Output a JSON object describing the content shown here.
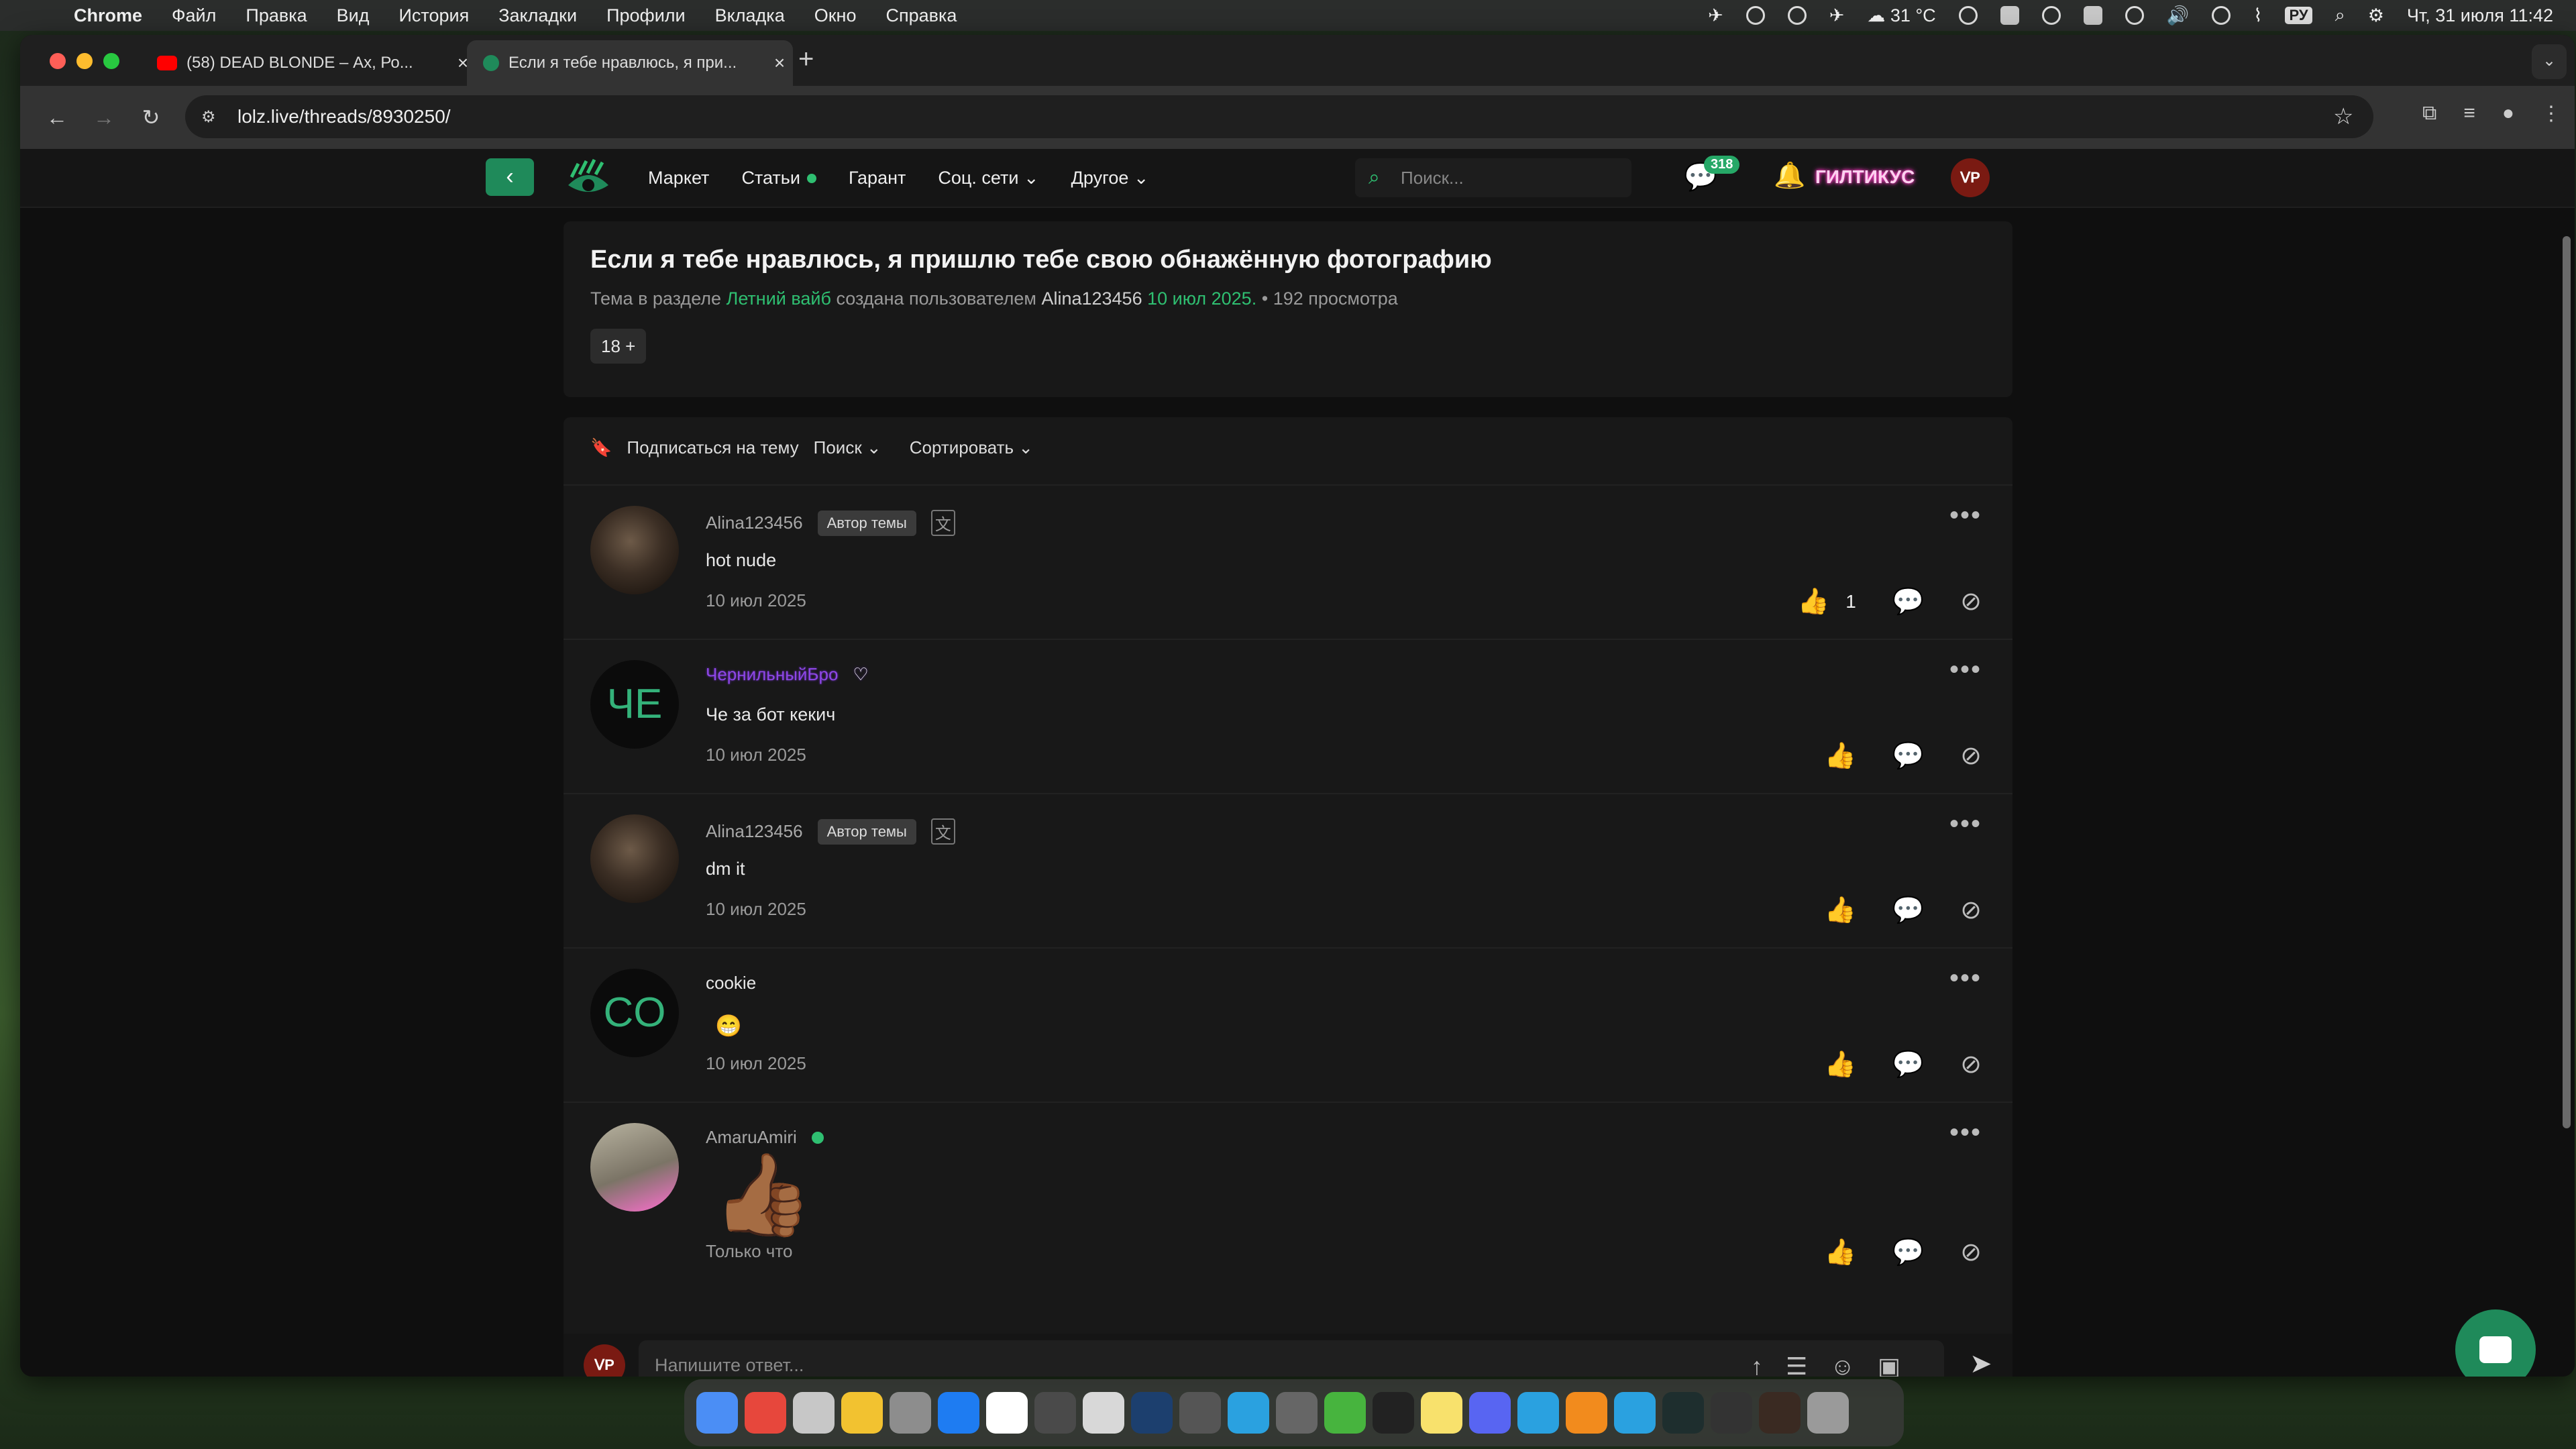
{
  "menubar": {
    "app": "Chrome",
    "items": [
      "Файл",
      "Правка",
      "Вид",
      "История",
      "Закладки",
      "Профили",
      "Вкладка",
      "Окно",
      "Справка"
    ],
    "weather": "31 °C",
    "datetime": "Чт, 31 июля  11:42",
    "kbd": "РУ"
  },
  "tabs": [
    {
      "title": "(58) DEAD BLONDE – Ах, Ро..."
    },
    {
      "title": "Если я тебе нравлюсь, я при..."
    }
  ],
  "omnibox": {
    "url": "lolz.live/threads/8930250/"
  },
  "nav": {
    "links": [
      "Маркет",
      "Статьи",
      "Гарант",
      "Соц. сети",
      "Другое"
    ],
    "search_placeholder": "Поиск...",
    "messages_badge": "318",
    "username": "ГИЛТИКУС",
    "avatar_text": "ᐯP"
  },
  "thread": {
    "title": "Если я тебе нравлюсь, я пришлю тебе свою обнажённую фотографию",
    "meta_prefix": "Тема в разделе",
    "section": "Летний вайб",
    "meta_mid": "создана пользователем",
    "author": "Alina123456",
    "date": "10 июл 2025.",
    "views": "• 192 просмотра",
    "tag": "18 +"
  },
  "toolbar": {
    "subscribe": "Подписаться на тему",
    "search": "Поиск",
    "sort": "Сортировать"
  },
  "posts": [
    {
      "user": "Alina123456",
      "badge": "Автор темы",
      "text": "hot nude",
      "date": "10 июл 2025",
      "likes": "1"
    },
    {
      "user": "ЧернильныйБро",
      "initials": "ЧЕ",
      "text": "Че за бот кекич",
      "date": "10 июл 2025"
    },
    {
      "user": "Alina123456",
      "badge": "Автор темы",
      "text": "dm it",
      "date": "10 июл 2025"
    },
    {
      "user": "cookie",
      "initials": "CO",
      "text": "😁",
      "date": "10 июл 2025"
    },
    {
      "user": "AmaruAmiri",
      "text": "👍🏾",
      "date": "Только что"
    }
  ],
  "reply": {
    "placeholder": "Напишите ответ..."
  },
  "colors": {
    "accent": "#2fbf71",
    "bg": "#0f0f0f",
    "card": "#181818"
  }
}
